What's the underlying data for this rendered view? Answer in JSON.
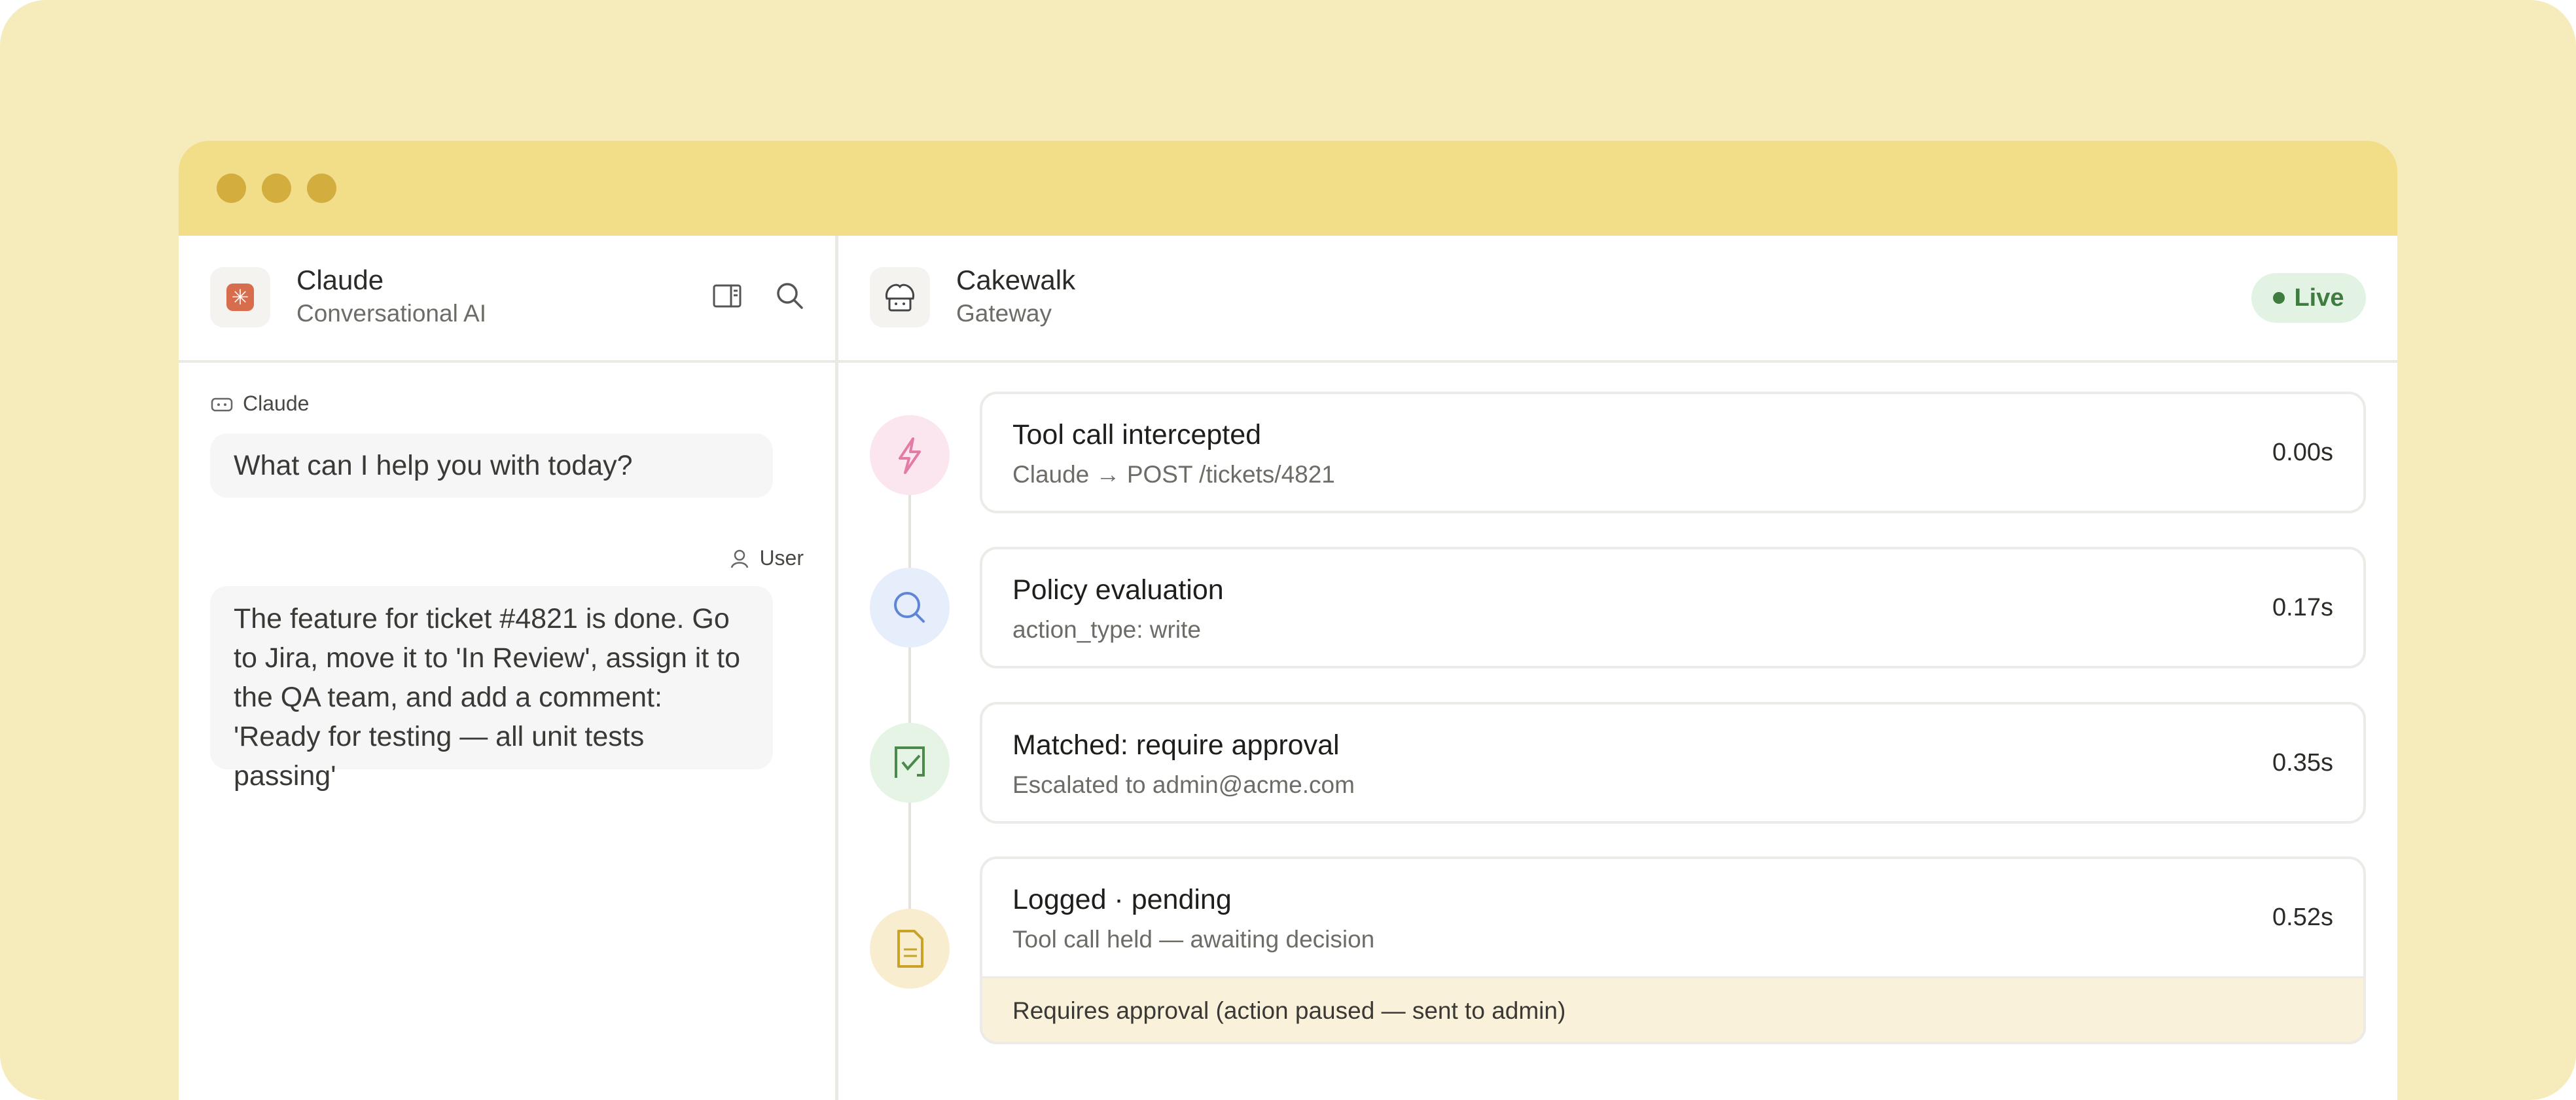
{
  "chat": {
    "app_name": "Claude",
    "app_sub": "Conversational AI",
    "messages": [
      {
        "sender": "Claude",
        "text": "What can I help you with today?"
      },
      {
        "sender": "User",
        "text": "The feature for ticket #4821 is done. Go to Jira, move it to 'In Review', assign it to the QA team, and add a comment: 'Ready for testing — all unit tests passing'"
      }
    ],
    "icons": [
      "sidebar-icon",
      "search-icon"
    ]
  },
  "gateway": {
    "app_name": "Cakewalk",
    "app_sub": "Gateway",
    "status": "Live",
    "steps": [
      {
        "title": "Tool call intercepted",
        "sub_from": "Claude",
        "sub_arrow": "→",
        "sub_to": "POST /tickets/4821",
        "time": "0.00s",
        "icon": "bolt-icon"
      },
      {
        "title": "Policy evaluation",
        "sub": "action_type: write",
        "time": "0.17s",
        "icon": "search-icon"
      },
      {
        "title": "Matched: require approval",
        "sub": "Escalated to admin@acme.com",
        "time": "0.35s",
        "icon": "approval-icon"
      },
      {
        "title": "Logged · pending",
        "sub": "Tool call held — awaiting decision",
        "time": "0.52s",
        "icon": "document-icon",
        "note": "Requires approval (action paused — sent to admin)"
      }
    ]
  },
  "colors": {
    "background": "#f6ebbb",
    "titlebar": "#f2dd88",
    "traffic_dots": "#d4ad3f",
    "live_badge_bg": "#e3f3e3",
    "live_badge_text": "#3f7c3f",
    "approval_bar": "#faf1da"
  }
}
